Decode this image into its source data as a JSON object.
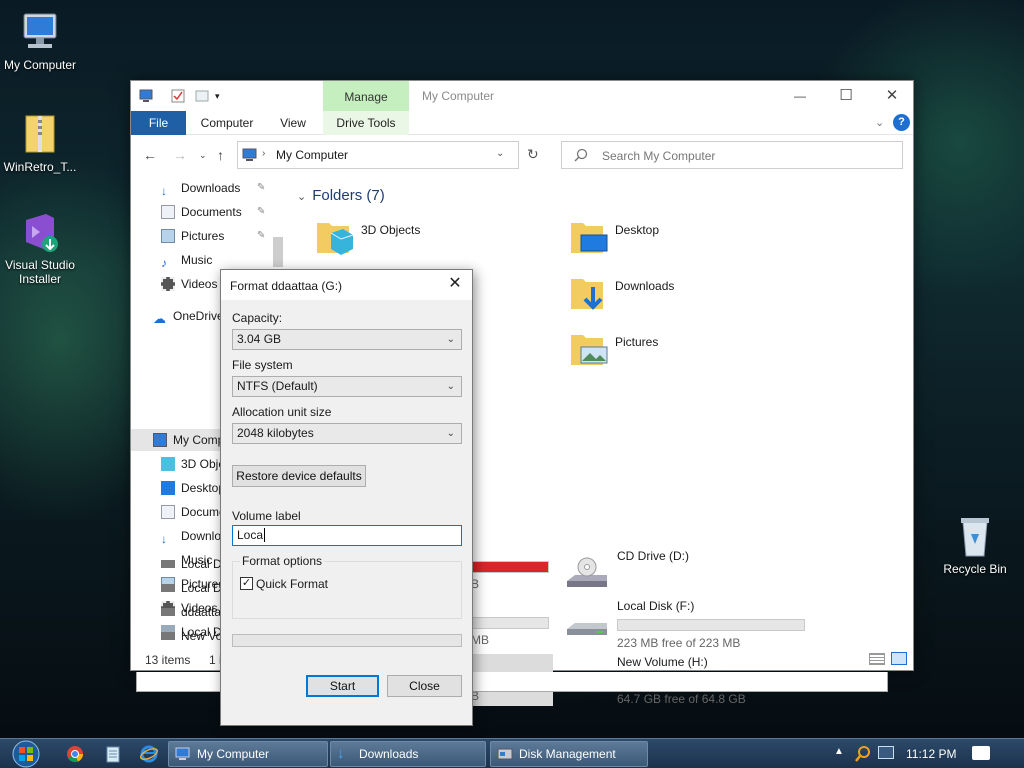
{
  "desktop": {
    "icons": [
      {
        "label": "My Computer"
      },
      {
        "label": "WinRetro_T..."
      },
      {
        "label": "Visual Studio Installer"
      },
      {
        "label": "Recycle Bin"
      }
    ]
  },
  "explorer": {
    "title": "My Computer",
    "manage_tab": "Manage",
    "tabs": {
      "file": "File",
      "computer": "Computer",
      "view": "View",
      "drive_tools": "Drive Tools"
    },
    "controls": {
      "minimize": "—",
      "maximize": "☐",
      "close": "✕"
    },
    "address": "My Computer",
    "search_placeholder": "Search My Computer",
    "nav": [
      {
        "label": "Downloads"
      },
      {
        "label": "Documents"
      },
      {
        "label": "Pictures"
      },
      {
        "label": "Music"
      },
      {
        "label": "Videos"
      },
      {
        "label": "OneDrive"
      },
      {
        "label": "My Computer"
      },
      {
        "label": "3D Objects"
      },
      {
        "label": "Desktop"
      },
      {
        "label": "Documents"
      },
      {
        "label": "Downloads"
      },
      {
        "label": "Music"
      },
      {
        "label": "Pictures"
      },
      {
        "label": "Videos"
      },
      {
        "label": "Local Disk"
      },
      {
        "label": "Local Disk"
      },
      {
        "label": "Local Disk"
      },
      {
        "label": "ddaattaa"
      },
      {
        "label": "New Volume"
      }
    ],
    "folders_header": "Folders (7)",
    "folders": [
      {
        "label": "3D Objects"
      },
      {
        "label": "Desktop"
      },
      {
        "label": "Downloads"
      },
      {
        "label": "Pictures"
      }
    ],
    "drives": [
      {
        "label": "CD Drive (D:)",
        "free": ""
      },
      {
        "label": "Local Disk (F:)",
        "free": "223 MB free of 223 MB"
      },
      {
        "label": "New Volume (H:)",
        "free": "64.7 GB free of 64.8 GB"
      }
    ],
    "partial_drive_text": [
      "B",
      "MB",
      "B"
    ],
    "status": {
      "items": "13 items",
      "selected": "1 i"
    }
  },
  "format_dialog": {
    "title": "Format ddaattaa (G:)",
    "capacity_label": "Capacity:",
    "capacity_value": "3.04 GB",
    "fs_label": "File system",
    "fs_value": "NTFS (Default)",
    "alloc_label": "Allocation unit size",
    "alloc_value": "2048 kilobytes",
    "restore_button": "Restore device defaults",
    "volume_label": "Volume label",
    "volume_value": "Loca",
    "options_label": "Format options",
    "quick_format_label": "Quick Format",
    "quick_format_checked": true,
    "start_button": "Start",
    "close_button": "Close"
  },
  "taskbar": {
    "buttons": [
      {
        "label": "My Computer"
      },
      {
        "label": "Downloads"
      },
      {
        "label": "Disk Management"
      }
    ],
    "clock": "11:12 PM"
  },
  "colors": {
    "accent": "#0078d7",
    "file_tab": "#1f5fa5",
    "manage_tab": "#c6efc0",
    "drive_bar_full": "#da2626"
  }
}
